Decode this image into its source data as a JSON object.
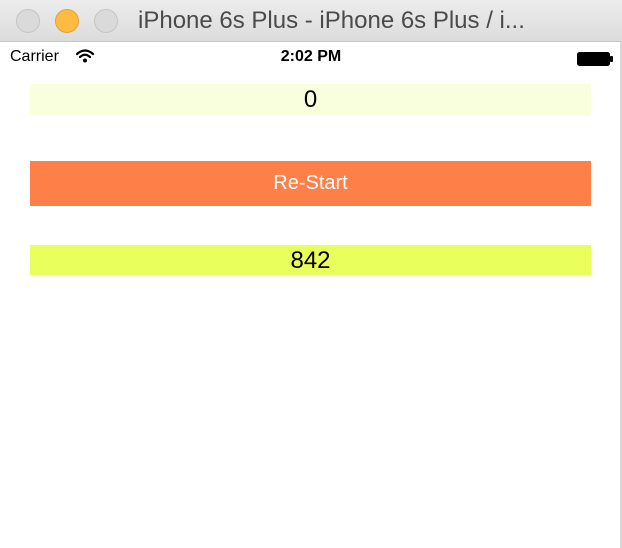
{
  "window": {
    "title": "iPhone 6s Plus - iPhone 6s Plus / i..."
  },
  "status_bar": {
    "carrier": "Carrier",
    "time": "2:02 PM",
    "icons": [
      "wifi-icon",
      "battery-icon"
    ]
  },
  "app": {
    "counter_value": "0",
    "restart_label": "Re-Start",
    "result_value": "842"
  },
  "colors": {
    "counter_bg": "#f9ffdc",
    "restart_bg": "#ff7f48",
    "result_bg": "#e8ff5c",
    "minimize_button": "#fdbc40"
  }
}
